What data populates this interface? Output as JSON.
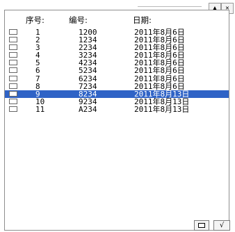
{
  "window": {
    "minimize_glyph": "▲",
    "close_glyph": "✕"
  },
  "header": {
    "seq_label": "序号:",
    "num_label": "编号:",
    "date_label": "日期:"
  },
  "rows": [
    {
      "seq": "1",
      "num": "1200",
      "date": "2011年8月6日",
      "selected": false
    },
    {
      "seq": "2",
      "num": "1234",
      "date": "2011年8月6日",
      "selected": false
    },
    {
      "seq": "3",
      "num": "2234",
      "date": "2011年8月6日",
      "selected": false
    },
    {
      "seq": "4",
      "num": "3234",
      "date": "2011年8月6日",
      "selected": false
    },
    {
      "seq": "5",
      "num": "4234",
      "date": "2011年8月6日",
      "selected": false
    },
    {
      "seq": "6",
      "num": "5234",
      "date": "2011年8月6日",
      "selected": false
    },
    {
      "seq": "7",
      "num": "6234",
      "date": "2011年8月6日",
      "selected": false
    },
    {
      "seq": "8",
      "num": "7234",
      "date": "2011年8月6日",
      "selected": false
    },
    {
      "seq": "9",
      "num": "8234",
      "date": "2011年8月13日",
      "selected": true
    },
    {
      "seq": "10",
      "num": "9234",
      "date": "2011年8月13日",
      "selected": false
    },
    {
      "seq": "11",
      "num": "A234",
      "date": "2011年8月13日",
      "selected": false
    }
  ],
  "footer": {
    "square_button_icon": "square-icon",
    "ok_button_glyph": "√"
  },
  "colors": {
    "selection": "#2f63c6",
    "border": "#8e8e8e"
  }
}
